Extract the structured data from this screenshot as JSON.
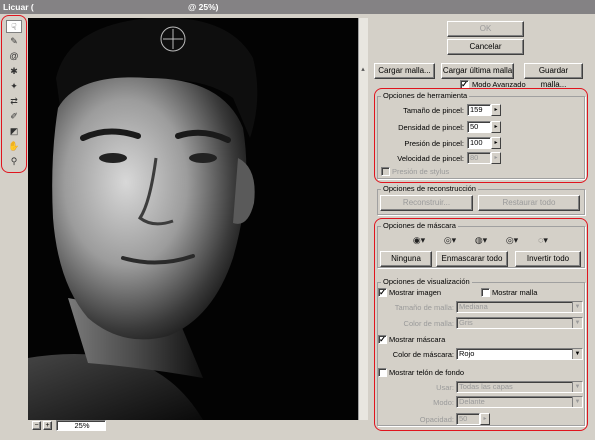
{
  "window": {
    "title": "Licuar (",
    "zoom_title": "@ 25%)"
  },
  "tools": [
    {
      "icon": "warp-tool-icon",
      "glyph": "☟"
    },
    {
      "icon": "reconstruct-tool-icon",
      "glyph": "✎"
    },
    {
      "icon": "twirl-tool-icon",
      "glyph": "@"
    },
    {
      "icon": "pucker-tool-icon",
      "glyph": "✱"
    },
    {
      "icon": "bloat-tool-icon",
      "glyph": "✦"
    },
    {
      "icon": "push-left-tool-icon",
      "glyph": "⇄"
    },
    {
      "icon": "freeze-mask-tool-icon",
      "glyph": "✐"
    },
    {
      "icon": "thaw-mask-tool-icon",
      "glyph": "◩"
    },
    {
      "icon": "hand-tool-icon",
      "glyph": "✋"
    },
    {
      "icon": "zoom-tool-icon",
      "glyph": "⚲"
    }
  ],
  "status": {
    "zoom": "25%",
    "minus": "−",
    "plus": "+"
  },
  "buttons": {
    "ok": "OK",
    "cancel": "Cancelar",
    "load_mesh": "Cargar malla...",
    "load_last_mesh": "Cargar última malla",
    "save_mesh": "Guardar malla..."
  },
  "advanced_mode": {
    "label": "Modo Avanzado",
    "checked": true
  },
  "tool_options": {
    "legend": "Opciones de herramienta",
    "brush_size_label": "Tamaño de pincel:",
    "brush_size": "159",
    "brush_density_label": "Densidad de pincel:",
    "brush_density": "50",
    "brush_pressure_label": "Presión de pincel:",
    "brush_pressure": "100",
    "brush_rate_label": "Velocidad de pincel:",
    "brush_rate": "80",
    "stylus_pressure": "Presión de stylus"
  },
  "reconstruct_options": {
    "legend": "Opciones de reconstrucción",
    "reconstruct": "Reconstruir...",
    "restore_all": "Restaurar todo"
  },
  "mask_options": {
    "legend": "Opciones de máscara",
    "none": "Ninguna",
    "mask_all": "Enmascarar todo",
    "invert_all": "Invertir todo"
  },
  "view_options": {
    "legend": "Opciones de visualización",
    "show_image": "Mostrar imagen",
    "show_mesh": "Mostrar malla",
    "mesh_size_label": "Tamaño de malla:",
    "mesh_size": "Mediana",
    "mesh_color_label": "Color de malla:",
    "mesh_color": "Gris",
    "show_mask": "Mostrar máscara",
    "mask_color_label": "Color de máscara:",
    "mask_color": "Rojo",
    "show_backdrop": "Mostrar telón de fondo",
    "use_label": "Usar:",
    "use_value": "Todas las capas",
    "mode_label": "Modo:",
    "mode_value": "Delante",
    "opacity_label": "Opacidad:",
    "opacity_value": "50"
  },
  "colors": {
    "highlight": "#e0141e",
    "dialog": "#d4d0c8",
    "titlebar": "#848284"
  }
}
